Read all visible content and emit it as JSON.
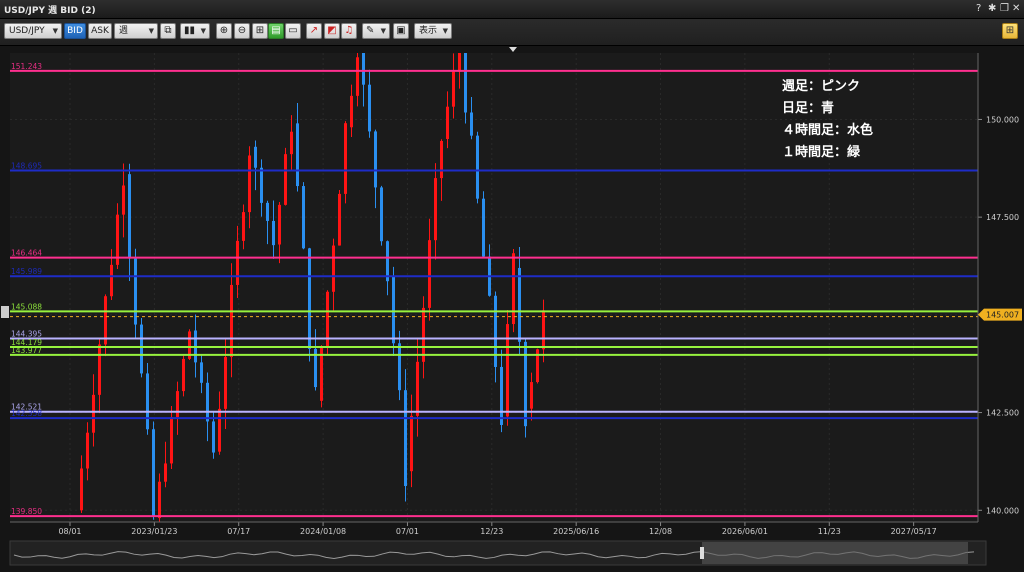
{
  "window": {
    "title": "USD/JPY 週 BID (2)"
  },
  "toolbar": {
    "symbol": "USD/JPY",
    "bid_label": "BID",
    "ask_label": "ASK",
    "period": "週",
    "display_label": "表示"
  },
  "icons": [
    "help-icon",
    "settings-icon",
    "restore-icon",
    "close-icon",
    "copy-icon",
    "chart-type-icon",
    "zoom-in-icon",
    "zoom-out-icon",
    "layout-icon",
    "grid-icon",
    "window-icon",
    "draw-line-icon",
    "draw-rect-icon",
    "draw-text-icon",
    "pen-icon",
    "export-icon",
    "grid-toggle-icon"
  ],
  "colors": {
    "background": "#1b1b1b",
    "up": "#ff1414",
    "down": "#2a8ff0",
    "pink": "#ff2f8f",
    "blue": "#1e2cc8",
    "lavender": "#b9b3ff",
    "green": "#97f23e"
  },
  "legend": [
    "週足：ピンク",
    "日足：青",
    "４時間足：水色",
    "１時間足：緑"
  ],
  "current_price": "145.007",
  "chart_data": {
    "type": "candlestick",
    "y_ticks": [
      "150.000",
      "147.500",
      "145.000",
      "142.500",
      "140.000"
    ],
    "y_tick_values": [
      150,
      147.5,
      145,
      142.5,
      140
    ],
    "ylim": [
      139.7,
      151.7
    ],
    "x_ticks": [
      "08/01",
      "2023/01/23",
      "07/17",
      "2024/01/08",
      "07/01",
      "12/23",
      "2025/06/16",
      "12/08",
      "2026/06/01",
      "11/23",
      "2027/05/17"
    ],
    "last_price": 145.007,
    "h_lines": [
      {
        "price": 151.243,
        "label": "151.243",
        "color": "pink"
      },
      {
        "price": 148.695,
        "label": "148.695",
        "color": "blue"
      },
      {
        "price": 146.464,
        "label": "146.464",
        "color": "pink"
      },
      {
        "price": 145.989,
        "label": "145.989",
        "color": "blue"
      },
      {
        "price": 145.088,
        "label": "145.088",
        "color": "green"
      },
      {
        "price": 144.395,
        "label": "144.395",
        "color": "lavender"
      },
      {
        "price": 144.179,
        "label": "144.179",
        "color": "green"
      },
      {
        "price": 143.977,
        "label": "143.977",
        "color": "green"
      },
      {
        "price": 142.521,
        "label": "142.521",
        "color": "lavender"
      },
      {
        "price": 142.358,
        "label": "142.358",
        "color": "blue"
      },
      {
        "price": 139.85,
        "label": "139.850",
        "color": "pink"
      }
    ],
    "segments": [
      {
        "start": 140.0,
        "end": 148.6,
        "n": 8,
        "seed": 1
      },
      {
        "start": 148.6,
        "end": 139.8,
        "n": 5,
        "seed": 2
      },
      {
        "start": 139.8,
        "end": 144.6,
        "n": 6,
        "seed": 3
      },
      {
        "start": 144.6,
        "end": 141.5,
        "n": 4,
        "seed": 4
      },
      {
        "start": 141.5,
        "end": 149.3,
        "n": 6,
        "seed": 5
      },
      {
        "start": 149.3,
        "end": 146.8,
        "n": 4,
        "seed": 6
      },
      {
        "start": 146.8,
        "end": 149.9,
        "n": 3,
        "seed": 7
      },
      {
        "start": 149.9,
        "end": 142.8,
        "n": 4,
        "seed": 8
      },
      {
        "start": 142.8,
        "end": 149.8,
        "n": 5,
        "seed": 9
      },
      {
        "start": 149.8,
        "end": 151.9,
        "n": 2,
        "seed": 10
      },
      {
        "start": 151.9,
        "end": 146.0,
        "n": 5,
        "seed": 11
      },
      {
        "start": 146.0,
        "end": 141.0,
        "n": 3,
        "seed": 12
      },
      {
        "start": 141.0,
        "end": 149.5,
        "n": 6,
        "seed": 13
      },
      {
        "start": 149.5,
        "end": 151.9,
        "n": 3,
        "seed": 14
      },
      {
        "start": 151.9,
        "end": 142.4,
        "n": 7,
        "seed": 15
      },
      {
        "start": 142.4,
        "end": 146.2,
        "n": 2,
        "seed": 16
      },
      {
        "start": 146.2,
        "end": 142.6,
        "n": 2,
        "seed": 17
      },
      {
        "start": 142.6,
        "end": 145.0,
        "n": 3,
        "seed": 18
      }
    ]
  }
}
